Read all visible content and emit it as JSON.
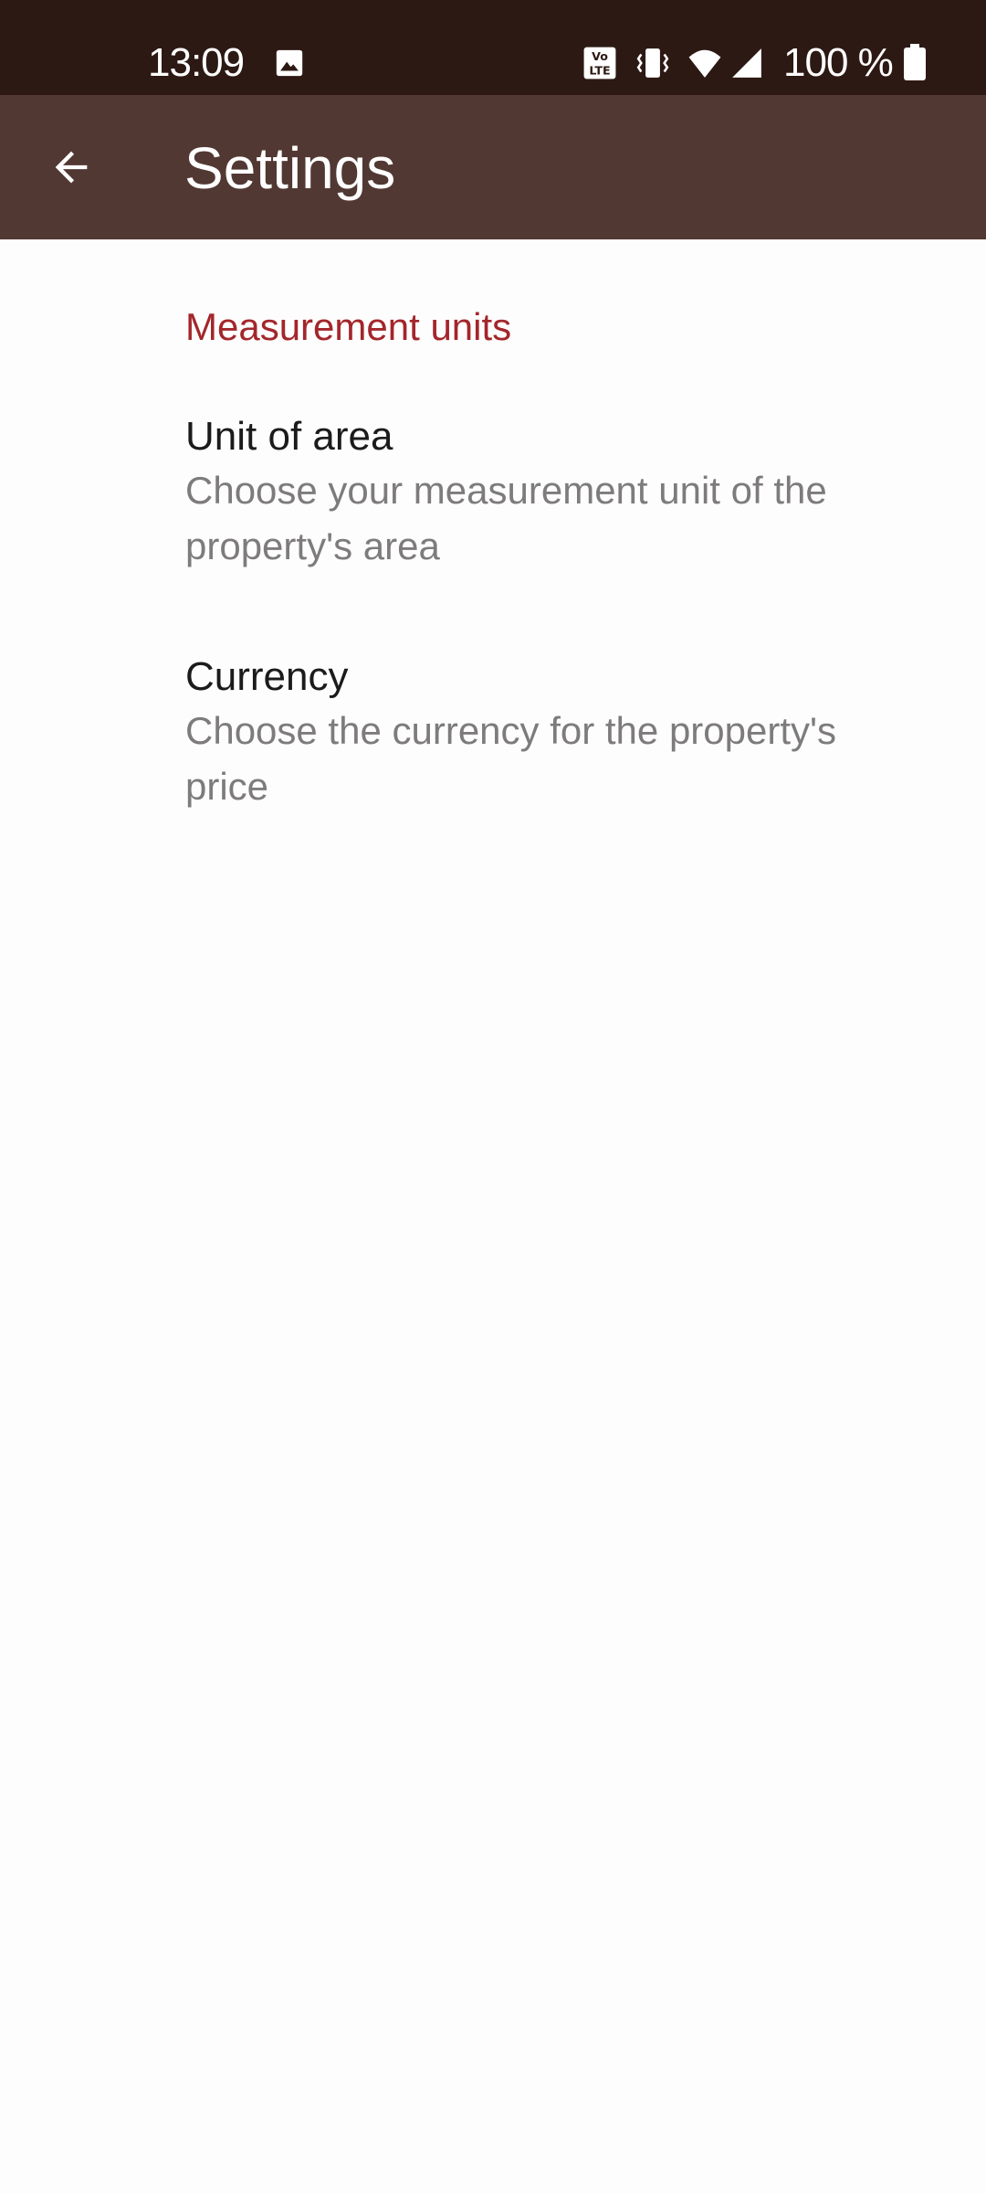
{
  "status_bar": {
    "time": "13:09",
    "battery": "100 %",
    "icons": [
      "image-icon",
      "volte-icon",
      "vibrate-icon",
      "wifi-icon",
      "signal-icon",
      "battery-icon"
    ]
  },
  "app_bar": {
    "title": "Settings",
    "back_icon": "arrow-left-icon"
  },
  "section": {
    "header": "Measurement units"
  },
  "preferences": [
    {
      "title": "Unit of area",
      "summary": "Choose your measurement unit of the property's area"
    },
    {
      "title": "Currency",
      "summary": "Choose the currency for the property's price"
    }
  ],
  "colors": {
    "status_bar": "#2d1914",
    "app_bar": "#523833",
    "accent": "#a3262b",
    "background": "#fefdfd",
    "title_text": "#1c1b1b",
    "summary_text": "#7d7b7b"
  }
}
